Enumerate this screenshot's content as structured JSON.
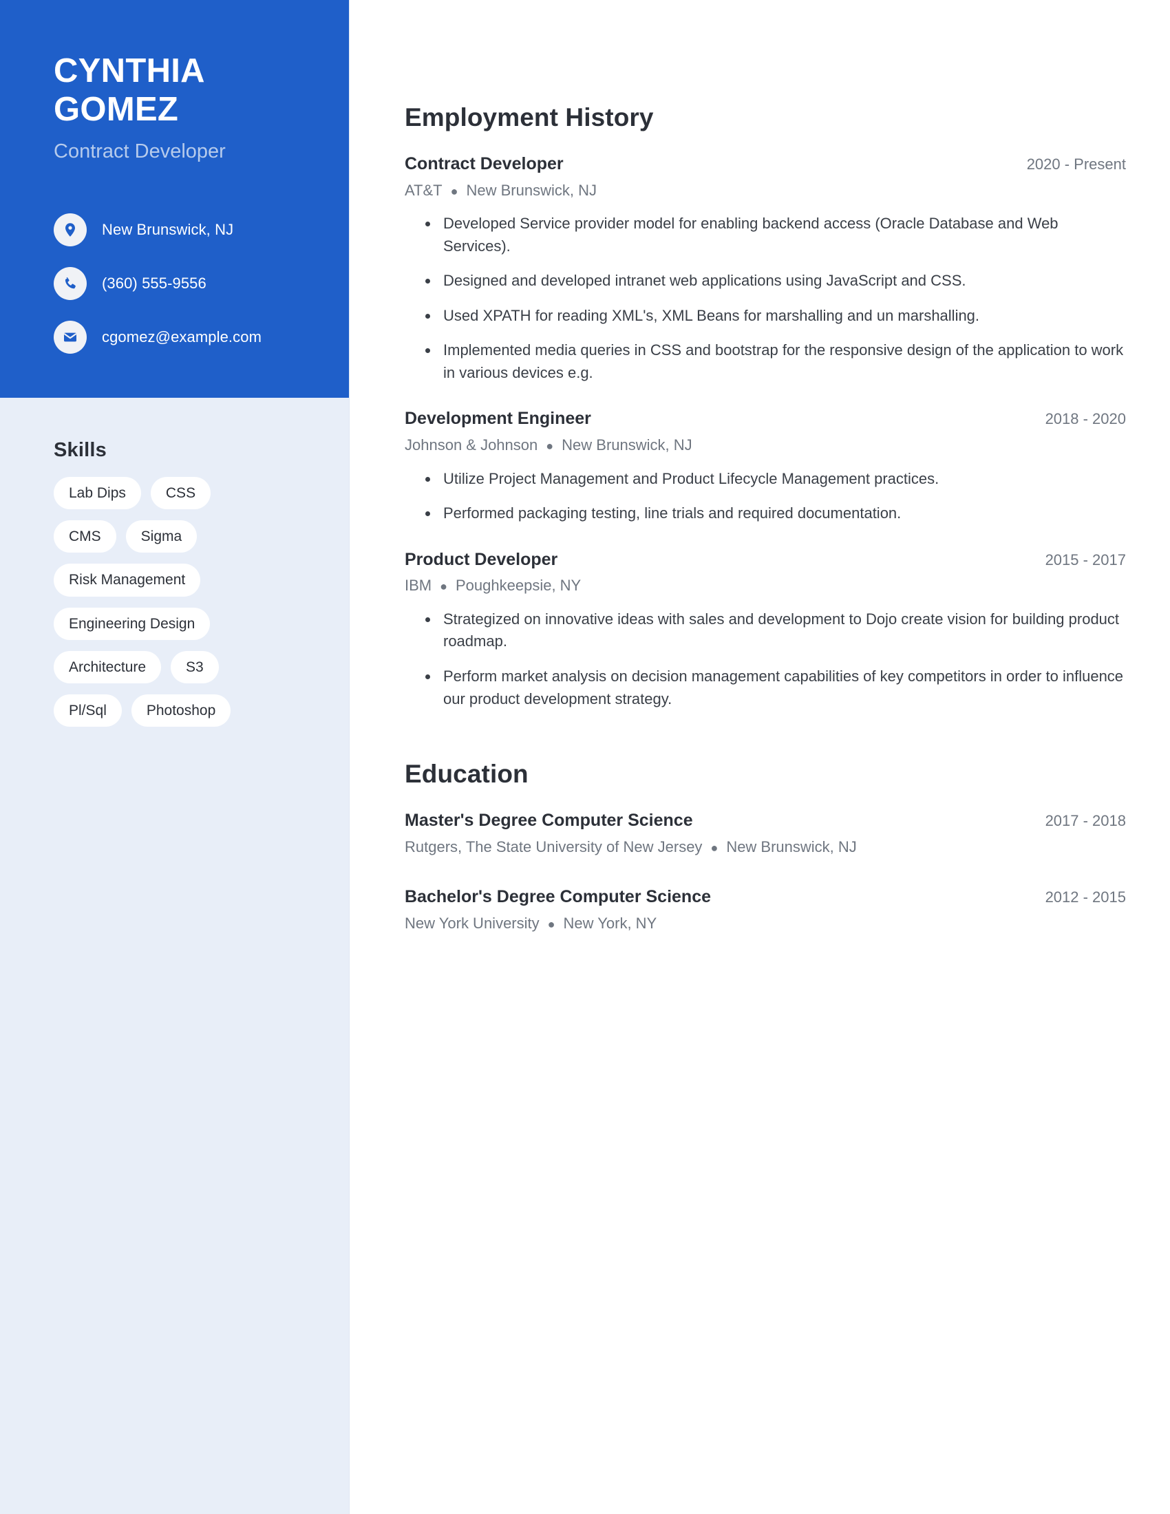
{
  "theme": {
    "accent": "#1f5fc9",
    "sidebar_bg": "#e8eef8",
    "subtitle_color": "#b6cbec",
    "text_color": "#2c3038",
    "muted_color": "#6f7680"
  },
  "profile": {
    "first_name": "CYNTHIA",
    "last_name": "GOMEZ",
    "title": "Contract Developer",
    "contacts": [
      {
        "icon": "location-pin-icon",
        "value": "New Brunswick, NJ"
      },
      {
        "icon": "phone-icon",
        "value": "(360) 555-9556"
      },
      {
        "icon": "envelope-icon",
        "value": "cgomez@example.com"
      }
    ]
  },
  "skills": {
    "heading": "Skills",
    "items": [
      "Lab Dips",
      "CSS",
      "CMS",
      "Sigma",
      "Risk Management",
      "Engineering Design",
      "Architecture",
      "S3",
      "Pl/Sql",
      "Photoshop"
    ]
  },
  "employment": {
    "heading": "Employment History",
    "entries": [
      {
        "role": "Contract Developer",
        "dates": "2020 - Present",
        "company": "AT&T",
        "location": "New Brunswick, NJ",
        "bullets": [
          "Developed Service provider model for enabling backend access (Oracle Database and Web Services).",
          "Designed and developed intranet web applications using JavaScript and CSS.",
          "Used XPATH for reading XML's, XML Beans for marshalling and un marshalling.",
          "Implemented media queries in CSS and bootstrap for the responsive design of the application to work in various devices e.g."
        ]
      },
      {
        "role": "Development Engineer",
        "dates": "2018 - 2020",
        "company": "Johnson & Johnson",
        "location": "New Brunswick, NJ",
        "bullets": [
          "Utilize Project Management and Product Lifecycle Management practices.",
          "Performed packaging testing, line trials and required documentation."
        ]
      },
      {
        "role": "Product Developer",
        "dates": "2015 - 2017",
        "company": "IBM",
        "location": "Poughkeepsie, NY",
        "bullets": [
          "Strategized on innovative ideas with sales and development to Dojo create vision for building product roadmap.",
          "Perform market analysis on decision management capabilities of key competitors in order to influence our product development strategy."
        ]
      }
    ]
  },
  "education": {
    "heading": "Education",
    "entries": [
      {
        "degree": "Master's Degree Computer Science",
        "dates": "2017 - 2018",
        "school": "Rutgers, The State University of New Jersey",
        "location": "New Brunswick, NJ"
      },
      {
        "degree": "Bachelor's Degree Computer Science",
        "dates": "2012 - 2015",
        "school": "New York University",
        "location": "New York, NY"
      }
    ]
  }
}
